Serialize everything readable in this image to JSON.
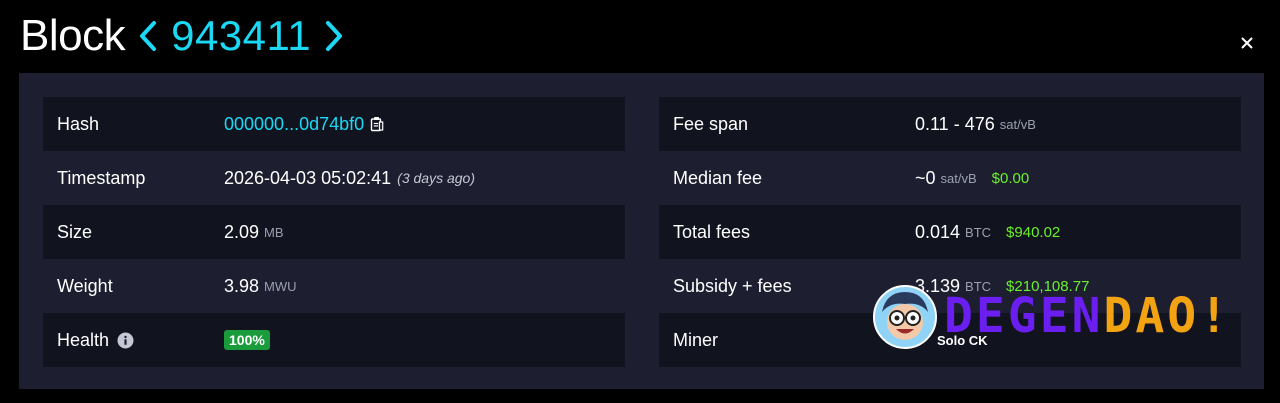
{
  "header": {
    "title": "Block",
    "block_number": "943411"
  },
  "details_left": {
    "hash": {
      "label": "Hash",
      "value": "000000...0d74bf0"
    },
    "timestamp": {
      "label": "Timestamp",
      "value": "2026-04-03 05:02:41",
      "relative": "(3 days ago)"
    },
    "size": {
      "label": "Size",
      "value": "2.09",
      "unit": "MB"
    },
    "weight": {
      "label": "Weight",
      "value": "3.98",
      "unit": "MWU"
    },
    "health": {
      "label": "Health",
      "value": "100%"
    }
  },
  "details_right": {
    "fee_span": {
      "label": "Fee span",
      "value": "0.11 - 476",
      "unit": "sat/vB"
    },
    "median_fee": {
      "label": "Median fee",
      "value": "~0",
      "unit": "sat/vB",
      "fiat": "$0.00"
    },
    "total_fees": {
      "label": "Total fees",
      "value": "0.014",
      "unit": "BTC",
      "fiat": "$940.02"
    },
    "subsidy_fees": {
      "label": "Subsidy + fees",
      "value": "3.139",
      "unit": "BTC",
      "fiat": "$210,108.77"
    },
    "miner": {
      "label": "Miner",
      "value": "Solo CK"
    }
  },
  "overlay": {
    "text_a": "DEGEN",
    "text_b": "DAO!"
  },
  "icons": {
    "prev": "chevron-left-icon",
    "next": "chevron-right-icon",
    "close": "close-icon",
    "copy": "copy-icon",
    "info": "info-icon"
  },
  "colors": {
    "accent": "#1bd8f4",
    "fiat": "#6cf02b",
    "health": "#1a9b3c",
    "panel": "#1d1f31",
    "row_shaded": "#11131f"
  }
}
